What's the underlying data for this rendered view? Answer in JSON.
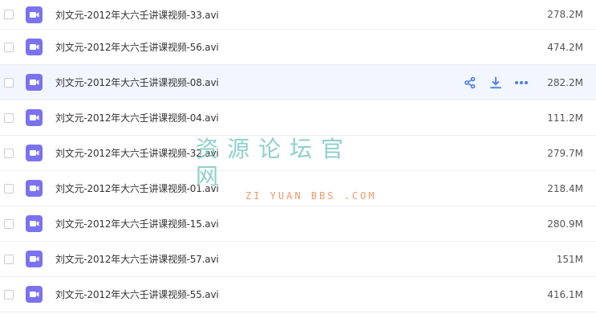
{
  "files": [
    {
      "name": "刘文元-2012年大六壬讲课视频-33.avi",
      "size": "278.2M",
      "icon": "video-file-icon",
      "hovered": false
    },
    {
      "name": "刘文元-2012年大六壬讲课视频-56.avi",
      "size": "474.2M",
      "icon": "video-file-icon",
      "hovered": false
    },
    {
      "name": "刘文元-2012年大六壬讲课视频-08.avi",
      "size": "282.2M",
      "icon": "video-file-icon",
      "hovered": true
    },
    {
      "name": "刘文元-2012年大六壬讲课视频-04.avi",
      "size": "111.2M",
      "icon": "video-file-icon",
      "hovered": false
    },
    {
      "name": "刘文元-2012年大六壬讲课视频-32.avi",
      "size": "279.7M",
      "icon": "video-file-icon",
      "hovered": false
    },
    {
      "name": "刘文元-2012年大六壬讲课视频-01.avi",
      "size": "218.4M",
      "icon": "video-file-icon",
      "hovered": false
    },
    {
      "name": "刘文元-2012年大六壬讲课视频-15.avi",
      "size": "280.9M",
      "icon": "video-file-icon",
      "hovered": false
    },
    {
      "name": "刘文元-2012年大六壬讲课视频-57.avi",
      "size": "151M",
      "icon": "video-file-icon",
      "hovered": false
    },
    {
      "name": "刘文元-2012年大六壬讲课视频-55.avi",
      "size": "416.1M",
      "icon": "video-file-icon",
      "hovered": false
    }
  ],
  "row_actions": [
    "share-icon",
    "download-icon",
    "more-icon"
  ],
  "watermark": {
    "title": "资源论坛官网",
    "subtitle": "ZI YUAN BBS .COM"
  },
  "colors": {
    "accent": "#4a7ee8",
    "file_icon": "#7b72f0",
    "hover_row": "#f2f6fe",
    "watermark_title": "#79c8c6",
    "watermark_subtitle": "#ea8a54"
  }
}
